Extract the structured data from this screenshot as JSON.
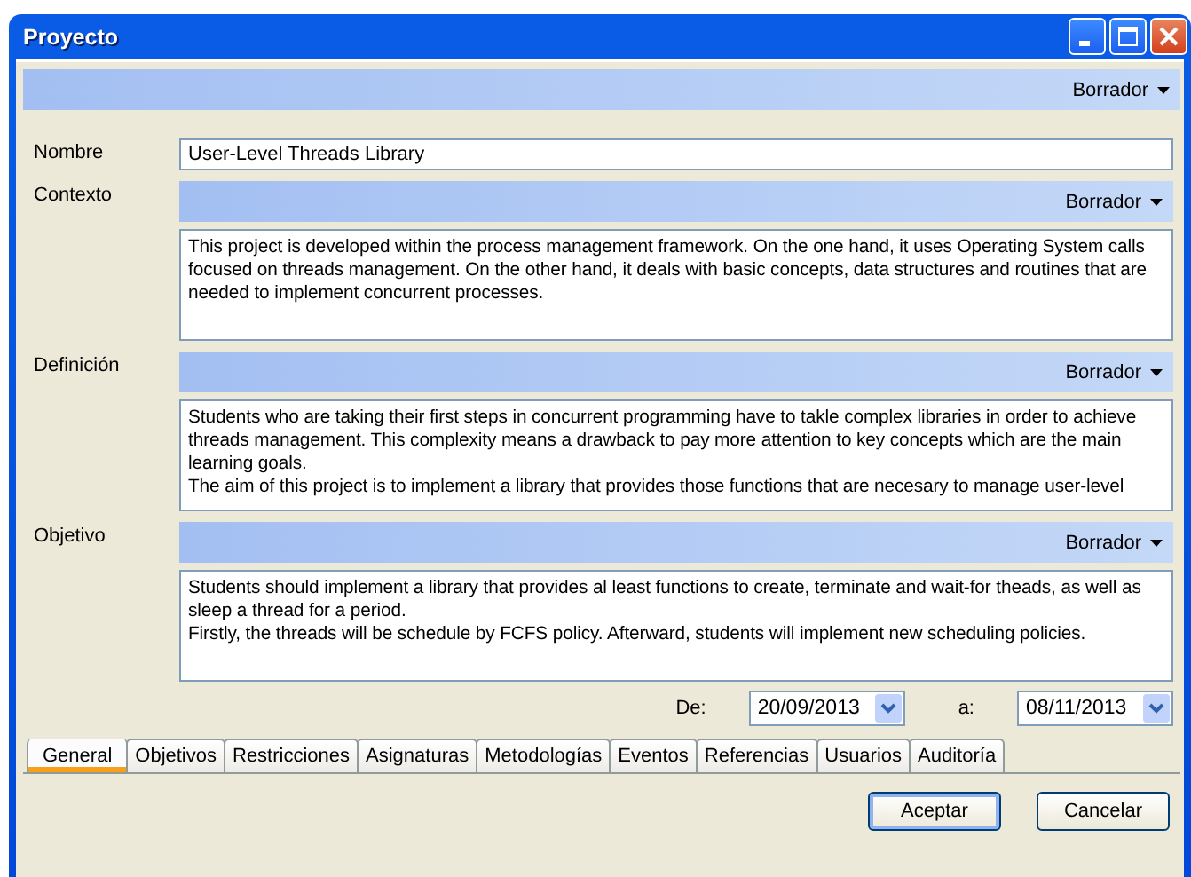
{
  "window": {
    "title": "Proyecto"
  },
  "status": {
    "label": "Borrador"
  },
  "fields": [
    {
      "kind": "text",
      "label": "Nombre",
      "value": "User-Level Threads Library"
    },
    {
      "kind": "rich",
      "label": "Contexto",
      "status": "Borrador",
      "value": "This project is developed within the process management framework. On the one hand, it uses Operating System calls focused on threads management. On the other hand, it deals with basic concepts, data structures and routines that are needed to implement concurrent processes."
    },
    {
      "kind": "rich",
      "label": "Definición",
      "status": "Borrador",
      "value": "Students who are taking their first steps in concurrent programming have to takle complex libraries in order to achieve threads management. This complexity means a drawback to pay more attention to key concepts which are the main learning goals.\nThe aim of this project is to implement a library that provides those functions that are necesary to manage user-level"
    },
    {
      "kind": "rich",
      "label": "Objetivo",
      "status": "Borrador",
      "value": "Students should implement a library that provides al least functions to create, terminate and wait-for theads, as well as sleep a thread for a period.\nFirstly, the threads will be schedule by FCFS policy. Afterward, students will implement new scheduling policies."
    }
  ],
  "dates": {
    "from_label": "De:",
    "from": "20/09/2013",
    "to_label": "a:",
    "to": "08/11/2013"
  },
  "tabs": [
    {
      "label": "General",
      "selected": true
    },
    {
      "label": "Objetivos",
      "selected": false
    },
    {
      "label": "Restricciones",
      "selected": false
    },
    {
      "label": "Asignaturas",
      "selected": false
    },
    {
      "label": "Metodologías",
      "selected": false
    },
    {
      "label": "Eventos",
      "selected": false
    },
    {
      "label": "Referencias",
      "selected": false
    },
    {
      "label": "Usuarios",
      "selected": false
    },
    {
      "label": "Auditoría",
      "selected": false
    }
  ],
  "buttons": [
    {
      "label": "Aceptar",
      "default": true
    },
    {
      "label": "Cancelar",
      "default": false
    }
  ]
}
